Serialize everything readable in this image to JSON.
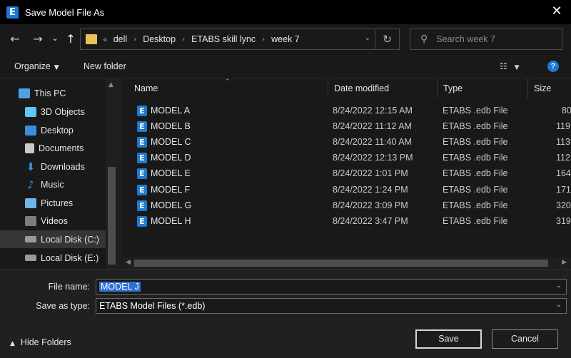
{
  "window": {
    "title": "Save Model File As",
    "app_icon_letter": "E",
    "close_glyph": "✕"
  },
  "nav": {
    "back_glyph": "←",
    "forward_glyph": "→",
    "recent_glyph": "⌄",
    "up_glyph": "↑",
    "breadcrumbs": [
      "dell",
      "Desktop",
      "ETABS skill lync",
      "week 7"
    ],
    "search_placeholder": "Search week 7"
  },
  "toolbar": {
    "organize_label": "Organize",
    "new_folder_label": "New folder",
    "help_glyph": "?"
  },
  "sidebar": {
    "items": [
      {
        "label": "This PC",
        "icon": "computer-icon",
        "color": "#4aa3e8"
      },
      {
        "label": "3D Objects",
        "icon": "cube-icon",
        "color": "#5bc8f5"
      },
      {
        "label": "Desktop",
        "icon": "desktop-icon",
        "color": "#3b8fe0"
      },
      {
        "label": "Documents",
        "icon": "document-icon",
        "color": "#c9c9c9"
      },
      {
        "label": "Downloads",
        "icon": "download-icon",
        "color": "#3b8fe0"
      },
      {
        "label": "Music",
        "icon": "music-icon",
        "color": "#3b8fe0"
      },
      {
        "label": "Pictures",
        "icon": "pictures-icon",
        "color": "#6fb5e8"
      },
      {
        "label": "Videos",
        "icon": "videos-icon",
        "color": "#7d7d7d"
      },
      {
        "label": "Local Disk (C:)",
        "icon": "drive-icon",
        "color": "#9a9a9a",
        "selected": true
      },
      {
        "label": "Local Disk (E:)",
        "icon": "drive-icon",
        "color": "#9a9a9a"
      }
    ]
  },
  "columns": {
    "name": "Name",
    "date": "Date modified",
    "type": "Type",
    "size": "Size"
  },
  "files": [
    {
      "name": "MODEL A",
      "date": "8/24/2022 12:15 AM",
      "type": "ETABS .edb File",
      "size": "80"
    },
    {
      "name": "MODEL B",
      "date": "8/24/2022 11:12 AM",
      "type": "ETABS .edb File",
      "size": "119"
    },
    {
      "name": "MODEL C",
      "date": "8/24/2022 11:40 AM",
      "type": "ETABS .edb File",
      "size": "113"
    },
    {
      "name": "MODEL D",
      "date": "8/24/2022 12:13 PM",
      "type": "ETABS .edb File",
      "size": "112"
    },
    {
      "name": "MODEL E",
      "date": "8/24/2022 1:01 PM",
      "type": "ETABS .edb File",
      "size": "164"
    },
    {
      "name": "MODEL F",
      "date": "8/24/2022 1:24 PM",
      "type": "ETABS .edb File",
      "size": "171"
    },
    {
      "name": "MODEL G",
      "date": "8/24/2022 3:09 PM",
      "type": "ETABS .edb File",
      "size": "320"
    },
    {
      "name": "MODEL H",
      "date": "8/24/2022 3:47 PM",
      "type": "ETABS .edb File",
      "size": "319"
    }
  ],
  "form": {
    "file_name_label": "File name:",
    "file_name_value": "MODEL J",
    "save_type_label": "Save as type:",
    "save_type_value": "ETABS Model Files (*.edb)",
    "hide_folders_label": "Hide Folders"
  },
  "buttons": {
    "save": "Save",
    "cancel": "Cancel"
  },
  "colors": {
    "accent": "#1c7ad6",
    "selection": "#2f6fd1",
    "folder": "#e8c15b"
  }
}
